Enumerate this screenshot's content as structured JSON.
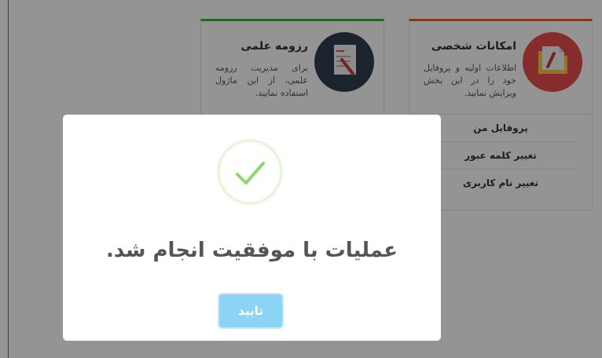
{
  "cards": {
    "personal": {
      "title": "امکانات شخصی",
      "description": "اطلاعات اولیه و پروفایل خود را در این بخش ویرایش نمایید.",
      "links": [
        "پروفایل من",
        "تغییر کلمه عبور",
        "تغییر نام کاربری"
      ]
    },
    "resume": {
      "title": "رزومه علمی",
      "description": "برای مدیریت رزومه علمی، از این ماژول استفاده نمایید."
    }
  },
  "modal": {
    "message": "عملیات با موفقیت انجام شد.",
    "confirm_label": "تایید",
    "success_color": "#8cd4f5"
  }
}
